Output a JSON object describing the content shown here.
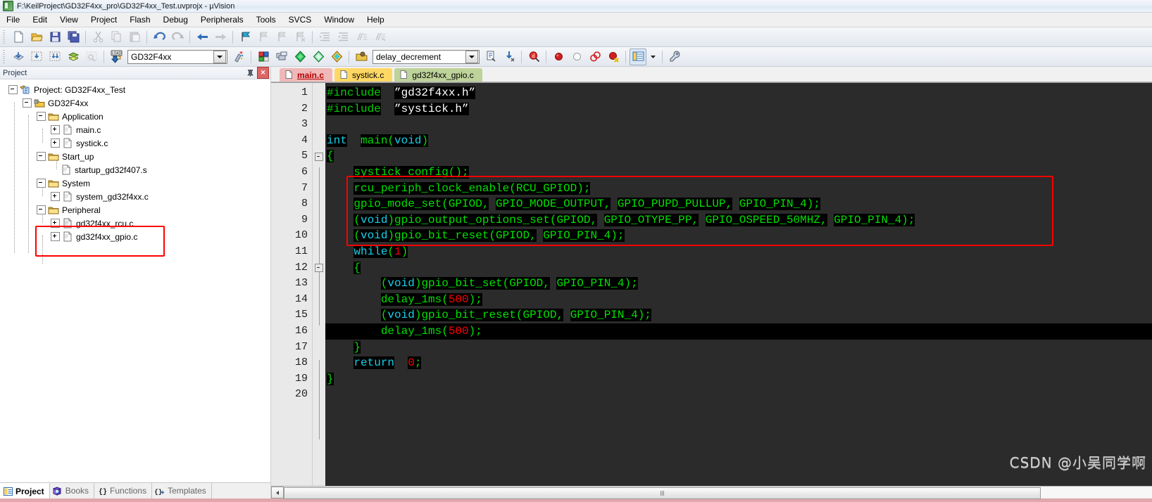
{
  "window": {
    "title": "F:\\KeilProject\\GD32F4xx_pro\\GD32F4xx_Test.uvprojx - µVision",
    "app_icon": "keil-uvision-icon"
  },
  "menubar": {
    "items": [
      {
        "label": "File"
      },
      {
        "label": "Edit"
      },
      {
        "label": "View"
      },
      {
        "label": "Project"
      },
      {
        "label": "Flash"
      },
      {
        "label": "Debug"
      },
      {
        "label": "Peripherals"
      },
      {
        "label": "Tools"
      },
      {
        "label": "SVCS"
      },
      {
        "label": "Window"
      },
      {
        "label": "Help"
      }
    ]
  },
  "toolbar_file": {
    "buttons": [
      {
        "name": "new-file-icon",
        "enabled": true
      },
      {
        "name": "open-file-icon",
        "enabled": true
      },
      {
        "name": "save-icon",
        "enabled": true
      },
      {
        "name": "save-all-icon",
        "enabled": true
      },
      {
        "name": "cut-icon",
        "enabled": false
      },
      {
        "name": "copy-icon",
        "enabled": false
      },
      {
        "name": "paste-icon",
        "enabled": false
      },
      {
        "name": "undo-icon",
        "enabled": true
      },
      {
        "name": "redo-icon",
        "enabled": false
      },
      {
        "name": "navigate-back-icon",
        "enabled": true
      },
      {
        "name": "navigate-forward-icon",
        "enabled": false
      },
      {
        "name": "bookmark-toggle-icon",
        "enabled": true
      },
      {
        "name": "bookmark-prev-icon",
        "enabled": false
      },
      {
        "name": "bookmark-next-icon",
        "enabled": false
      },
      {
        "name": "bookmark-clear-icon",
        "enabled": false
      },
      {
        "name": "indent-icon",
        "enabled": false
      },
      {
        "name": "outdent-icon",
        "enabled": false
      },
      {
        "name": "comment-icon",
        "enabled": false
      },
      {
        "name": "uncomment-icon",
        "enabled": false
      }
    ]
  },
  "toolbar_build": {
    "buttons": [
      {
        "name": "translate-icon",
        "enabled": true
      },
      {
        "name": "build-icon",
        "enabled": true
      },
      {
        "name": "rebuild-icon",
        "enabled": true
      },
      {
        "name": "batch-build-icon",
        "enabled": true
      },
      {
        "name": "stop-build-icon",
        "enabled": false
      },
      {
        "name": "download-icon",
        "enabled": true
      }
    ],
    "target_combo": {
      "name": "target-combo",
      "value": "GD32F4xx"
    },
    "after_target": [
      {
        "name": "target-options-icon",
        "enabled": true
      },
      {
        "name": "manage-project-items-icon",
        "enabled": true
      },
      {
        "name": "manage-multi-project-icon",
        "enabled": true
      },
      {
        "name": "pack-installer-icon",
        "enabled": true
      },
      {
        "name": "manage-run-time-env-icon",
        "enabled": true
      },
      {
        "name": "select-software-packs-icon",
        "enabled": true
      }
    ],
    "file_combo": {
      "name": "function-combo",
      "value": "delay_decrement"
    },
    "right_buttons": [
      {
        "name": "open-file-browser-icon",
        "enabled": true
      },
      {
        "name": "goto-definition-icon",
        "enabled": true
      },
      {
        "name": "insert-template-icon",
        "enabled": true
      },
      {
        "name": "find-in-files-icon",
        "enabled": true
      },
      {
        "name": "insert-breakpoint-icon",
        "enabled": true
      },
      {
        "name": "disable-breakpoint-icon",
        "enabled": true
      },
      {
        "name": "kill-all-breakpoints-icon",
        "enabled": true
      },
      {
        "name": "disable-all-breakpoints-icon",
        "enabled": true
      },
      {
        "name": "configure-windows-icon",
        "enabled": true
      },
      {
        "name": "configure-windows-dropdown-icon",
        "enabled": true
      },
      {
        "name": "customize-tools-icon",
        "enabled": true
      }
    ]
  },
  "project_pane": {
    "caption": "Project",
    "pin_icon": "pin-icon",
    "close_icon": "close-icon",
    "tree": [
      {
        "level": 0,
        "label": "Project: GD32F4xx_Test",
        "icon": "project-icon",
        "expander": "minus"
      },
      {
        "level": 1,
        "label": "GD32F4xx",
        "icon": "target-icon",
        "expander": "minus"
      },
      {
        "level": 2,
        "label": "Application",
        "icon": "folder-icon",
        "expander": "minus"
      },
      {
        "level": 3,
        "label": "main.c",
        "icon": "c-file-icon",
        "expander": "plus"
      },
      {
        "level": 3,
        "label": "systick.c",
        "icon": "c-file-icon",
        "expander": "plus"
      },
      {
        "level": 2,
        "label": "Start_up",
        "icon": "folder-icon",
        "expander": "minus"
      },
      {
        "level": 3,
        "label": "startup_gd32f407.s",
        "icon": "asm-file-icon",
        "expander": "none"
      },
      {
        "level": 2,
        "label": "System",
        "icon": "folder-icon",
        "expander": "minus"
      },
      {
        "level": 3,
        "label": "system_gd32f4xx.c",
        "icon": "c-file-icon",
        "expander": "plus"
      },
      {
        "level": 2,
        "label": "Peripheral",
        "icon": "folder-icon",
        "expander": "minus"
      },
      {
        "level": 3,
        "label": "gd32f4xx_rcu.c",
        "icon": "c-file-icon",
        "expander": "plus"
      },
      {
        "level": 3,
        "label": "gd32f4xx_gpio.c",
        "icon": "c-file-icon",
        "expander": "plus"
      }
    ],
    "annotation_box": {
      "name": "peripheral-files-highlight",
      "color": "#ff0000"
    },
    "tabs": [
      {
        "label": "Project",
        "icon": "project-tab-icon",
        "active": true
      },
      {
        "label": "Books",
        "icon": "books-tab-icon",
        "active": false
      },
      {
        "label": "Functions",
        "icon": "functions-tab-icon",
        "active": false
      },
      {
        "label": "Templates",
        "icon": "templates-tab-icon",
        "active": false
      }
    ]
  },
  "editor": {
    "tabs": [
      {
        "label": "main.c",
        "style": "main",
        "active": true
      },
      {
        "label": "systick.c",
        "style": "sys",
        "active": false
      },
      {
        "label": "gd32f4xx_gpio.c",
        "style": "gpio",
        "active": false
      }
    ],
    "line_numbers": [
      "1",
      "2",
      "3",
      "4",
      "5",
      "6",
      "7",
      "8",
      "9",
      "10",
      "11",
      "12",
      "13",
      "14",
      "15",
      "16",
      "17",
      "18",
      "19",
      "20"
    ],
    "lines": [
      {
        "n": 1,
        "text": "#include  \"gd32f4xx.h\""
      },
      {
        "n": 2,
        "text": "#include  \"systick.h\""
      },
      {
        "n": 3,
        "text": ""
      },
      {
        "n": 4,
        "text": "int  main(void)"
      },
      {
        "n": 5,
        "text": "{"
      },
      {
        "n": 6,
        "text": "    systick_config();"
      },
      {
        "n": 7,
        "text": "    rcu_periph_clock_enable(RCU_GPIOD);"
      },
      {
        "n": 8,
        "text": "    gpio_mode_set(GPIOD,  GPIO_MODE_OUTPUT,  GPIO_PUPD_PULLUP,  GPIO_PIN_4);"
      },
      {
        "n": 9,
        "text": "    (void)gpio_output_options_set(GPIOD,  GPIO_OTYPE_PP,  GPIO_OSPEED_50MHZ,  GPIO_PIN_4);"
      },
      {
        "n": 10,
        "text": "    (void)gpio_bit_reset(GPIOD,  GPIO_PIN_4);"
      },
      {
        "n": 11,
        "text": "    while(1)"
      },
      {
        "n": 12,
        "text": "    {"
      },
      {
        "n": 13,
        "text": "        (void)gpio_bit_set(GPIOD,  GPIO_PIN_4);"
      },
      {
        "n": 14,
        "text": "        delay_1ms(500);"
      },
      {
        "n": 15,
        "text": "        (void)gpio_bit_reset(GPIOD,  GPIO_PIN_4);"
      },
      {
        "n": 16,
        "text": "        delay_1ms(500);"
      },
      {
        "n": 17,
        "text": "    }"
      },
      {
        "n": 18,
        "text": "    return  0;"
      },
      {
        "n": 19,
        "text": "}"
      },
      {
        "n": 20,
        "text": ""
      }
    ],
    "current_line": 16,
    "annotation_box": {
      "name": "gpio-init-code-highlight",
      "color": "#ff0000",
      "from_line": 7,
      "to_line": 10
    },
    "colors": {
      "background": "#2b2b2b",
      "highlight": "#000000",
      "identifier": "#00e000",
      "keyword": "#16d0e8",
      "number": "#ff0000",
      "string": "#ffffff",
      "preprocessor": "#00d000",
      "gutter_background": "#e9e9e9"
    },
    "hscrollbar": {
      "name": "editor-horizontal-scrollbar"
    }
  },
  "watermark": {
    "text": "CSDN @小吴同学啊"
  }
}
